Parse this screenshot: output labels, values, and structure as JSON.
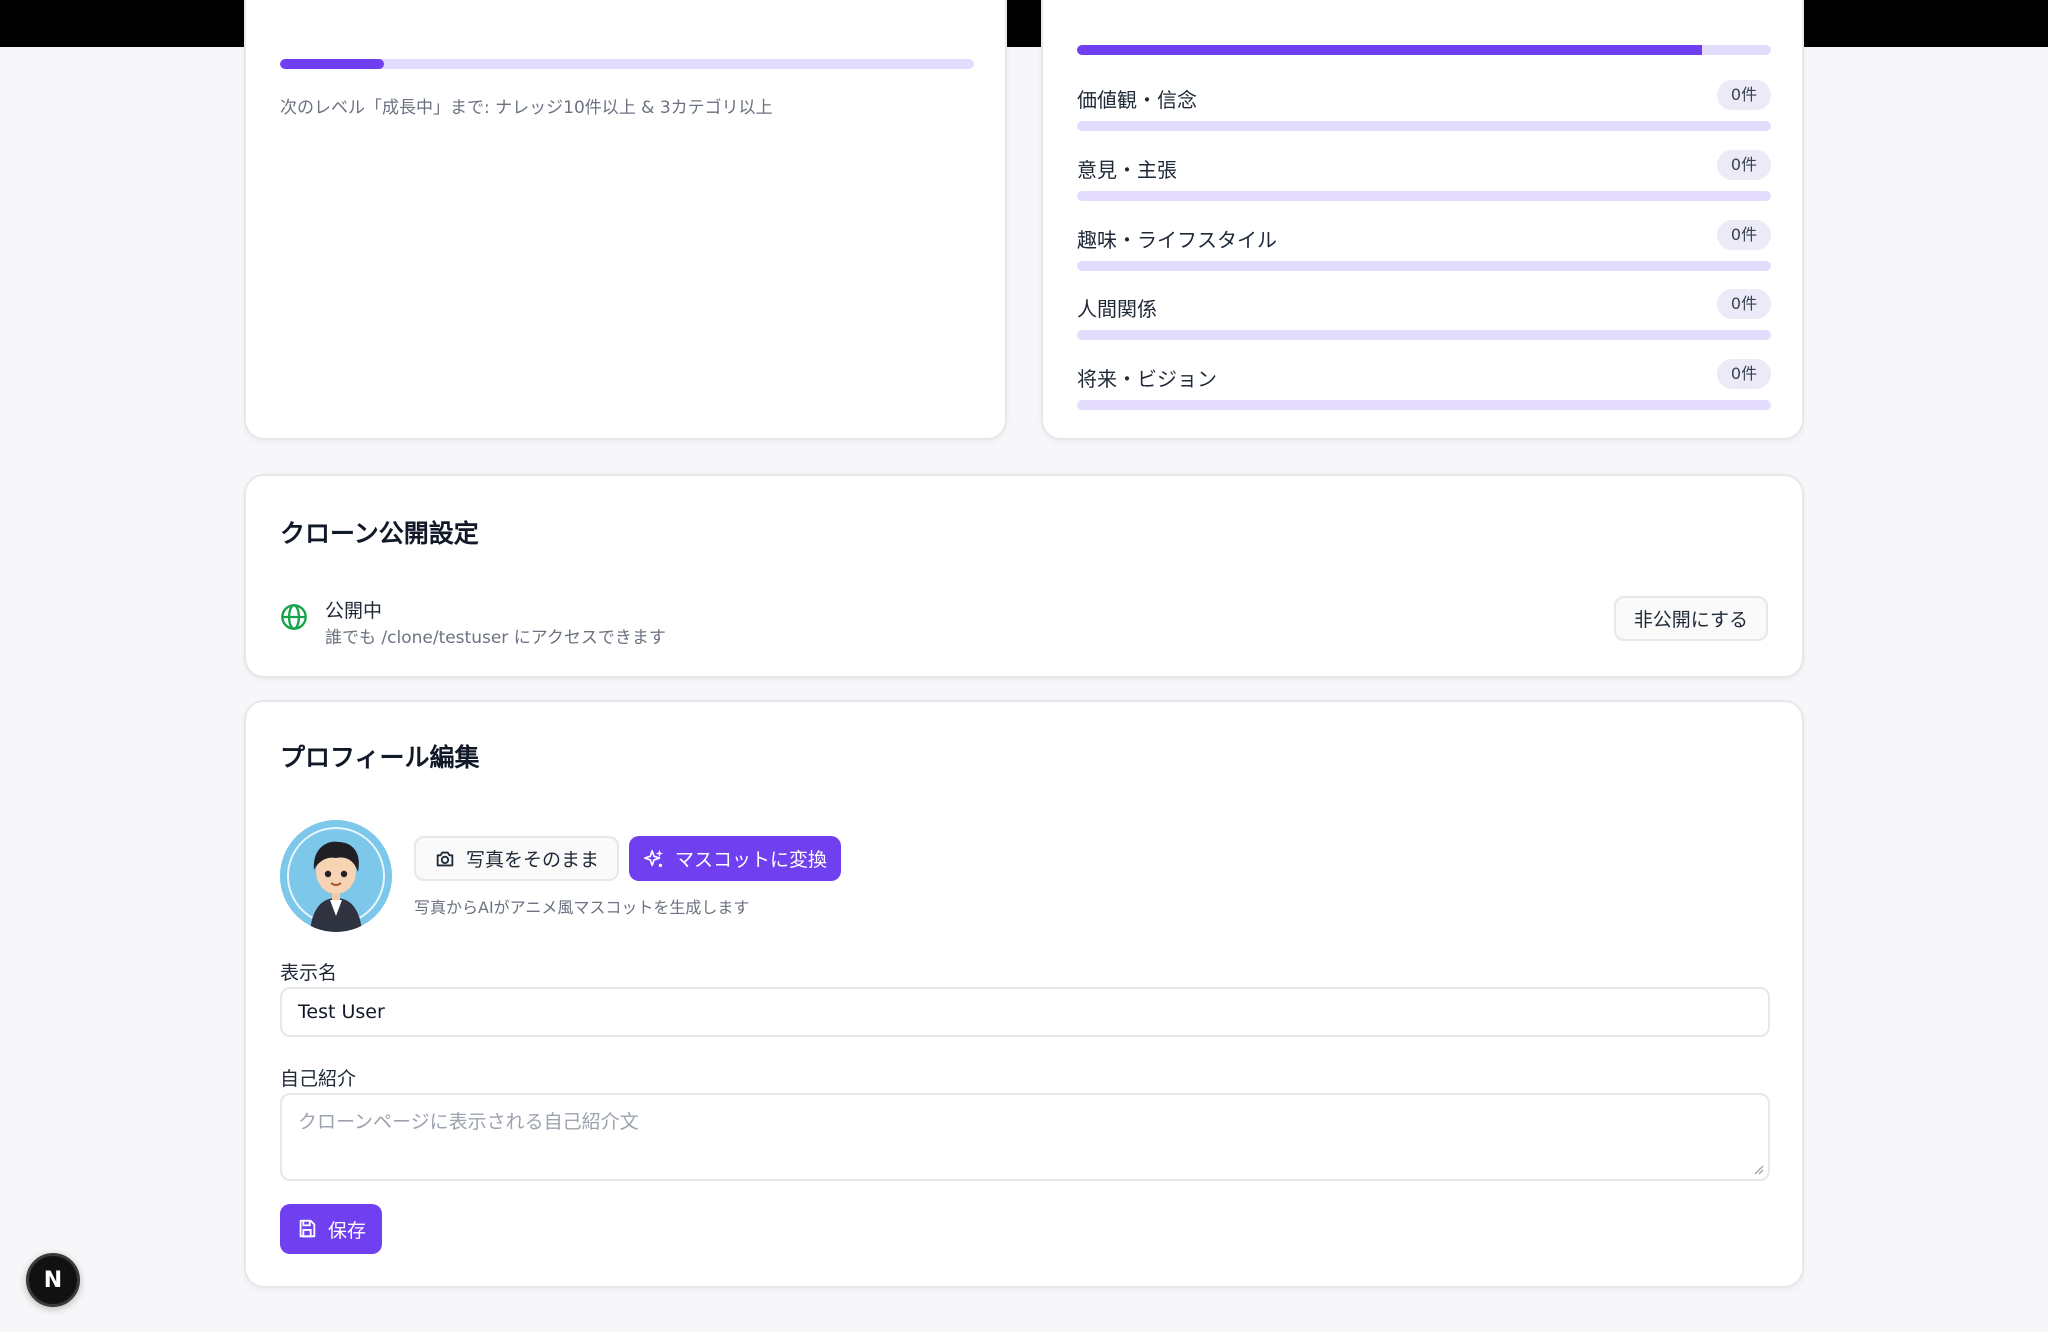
{
  "level_card": {
    "progress_percent": 15,
    "next_level_note": "次のレベル「成長中」まで: ナレッジ10件以上 & 3カテゴリ以上"
  },
  "categories_card": {
    "top_progress_percent": 90,
    "items": [
      {
        "label": "価値観・信念",
        "count": "0件",
        "progress_percent": 0
      },
      {
        "label": "意見・主張",
        "count": "0件",
        "progress_percent": 0
      },
      {
        "label": "趣味・ライフスタイル",
        "count": "0件",
        "progress_percent": 0
      },
      {
        "label": "人間関係",
        "count": "0件",
        "progress_percent": 0
      },
      {
        "label": "将来・ビジョン",
        "count": "0件",
        "progress_percent": 0
      }
    ]
  },
  "publish_card": {
    "title": "クローン公開設定",
    "status": "公開中",
    "description": "誰でも /clone/testuser にアクセスできます",
    "unpublish_button": "非公開にする",
    "icon": "globe-icon",
    "status_color": "#16a34a"
  },
  "profile_card": {
    "title": "プロフィール編集",
    "photo_button": "写真をそのまま",
    "mascot_button": "マスコットに変換",
    "mascot_help": "写真からAIがアニメ風マスコットを生成します",
    "display_name_label": "表示名",
    "display_name_value": "Test User",
    "bio_label": "自己紹介",
    "bio_placeholder": "クローンページに表示される自己紹介文",
    "save_button": "保存"
  },
  "dev_badge": {
    "label": "N"
  },
  "colors": {
    "accent": "#7040f0",
    "track": "#e4dcfd"
  }
}
